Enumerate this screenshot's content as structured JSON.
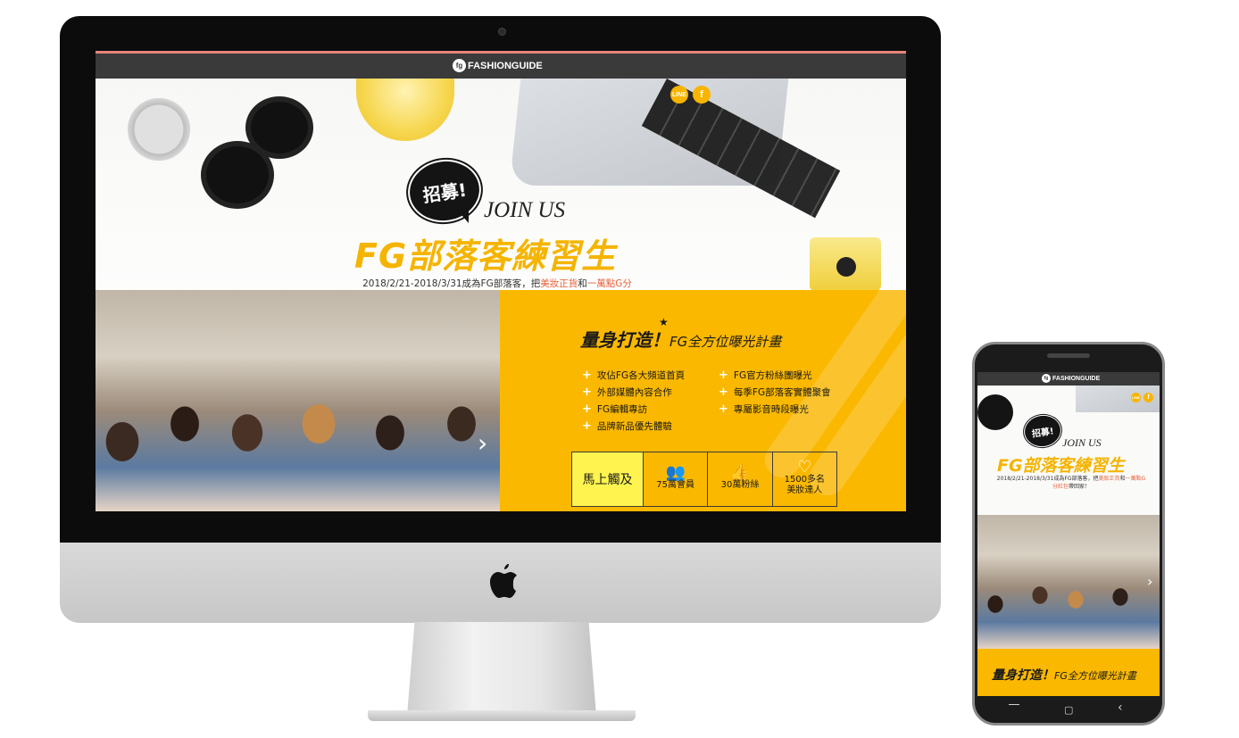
{
  "site": {
    "logo_mark": "fg",
    "logo_text": "FASHIONGUIDE"
  },
  "social": {
    "line_label": "LINE",
    "facebook_label": "f"
  },
  "hero": {
    "badge": "招募!",
    "join": "JOIN US",
    "title": "FG部落客練習生",
    "desc_prefix": "2018/2/21-2018/3/31成為FG部落客，把",
    "desc_hl1": "美妝正貨",
    "desc_mid": "和",
    "desc_hl2": "一萬點G分",
    "desc_hl3": "紅包",
    "desc_suffix": "帶回家！"
  },
  "photo": {
    "next_arrow": "›"
  },
  "plan": {
    "title_main": "量身打造！",
    "title_sub": "FG全方位曝光計畫",
    "star": "★",
    "features_left": [
      "攻佔FG各大頻道首頁",
      "外部媒體內容合作",
      "FG編輯專訪",
      "品牌新品優先體驗"
    ],
    "features_right": [
      "FG官方粉絲團曝光",
      "每季FG部落客實體聚會",
      "專屬影音時段曝光"
    ],
    "plus": "+"
  },
  "stats": {
    "lead": "馬上觸及",
    "items": [
      {
        "icon": "users-icon",
        "glyph": "👥",
        "label": "75萬會員"
      },
      {
        "icon": "thumbs-up-icon",
        "glyph": "👍",
        "label": "30萬粉絲"
      },
      {
        "icon": "heart-icon",
        "glyph": "♡",
        "label_line1": "1500多名",
        "label_line2": "美妝達人"
      }
    ]
  },
  "phone_nav": {
    "back": "‹",
    "home": "○",
    "recent": "▢"
  },
  "colors": {
    "accent_yellow": "#fbb800",
    "title_yellow": "#f5b400",
    "highlight_red": "#e8613b",
    "topbar": "#3a3a3a",
    "topbar_border": "#e8857a"
  }
}
